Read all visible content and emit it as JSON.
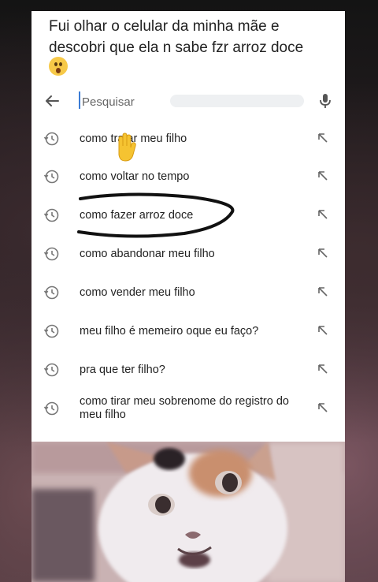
{
  "post": {
    "caption": "Fui olhar o celular da minha mãe e descobri que ela n sabe fzr arroz doce",
    "caption_emoji": "astonished-face-emoji"
  },
  "search": {
    "placeholder": "Pesquisar",
    "back_icon": "arrow-left-icon",
    "mic_icon": "microphone-icon"
  },
  "suggestions": [
    {
      "text": "como tratar meu filho"
    },
    {
      "text": "como voltar no tempo"
    },
    {
      "text": "como fazer arroz doce"
    },
    {
      "text": "como abandonar meu filho"
    },
    {
      "text": "como vender meu filho"
    },
    {
      "text": "meu filho é memeiro oque eu faço?"
    },
    {
      "text": "pra que ter filho?"
    },
    {
      "text": "como tirar meu sobrenome do registro do meu filho"
    }
  ],
  "colors": {
    "panel": "#ffffff",
    "text": "#222222",
    "icon": "#777777",
    "scribble": "#111111",
    "hand": "#f5c331"
  }
}
